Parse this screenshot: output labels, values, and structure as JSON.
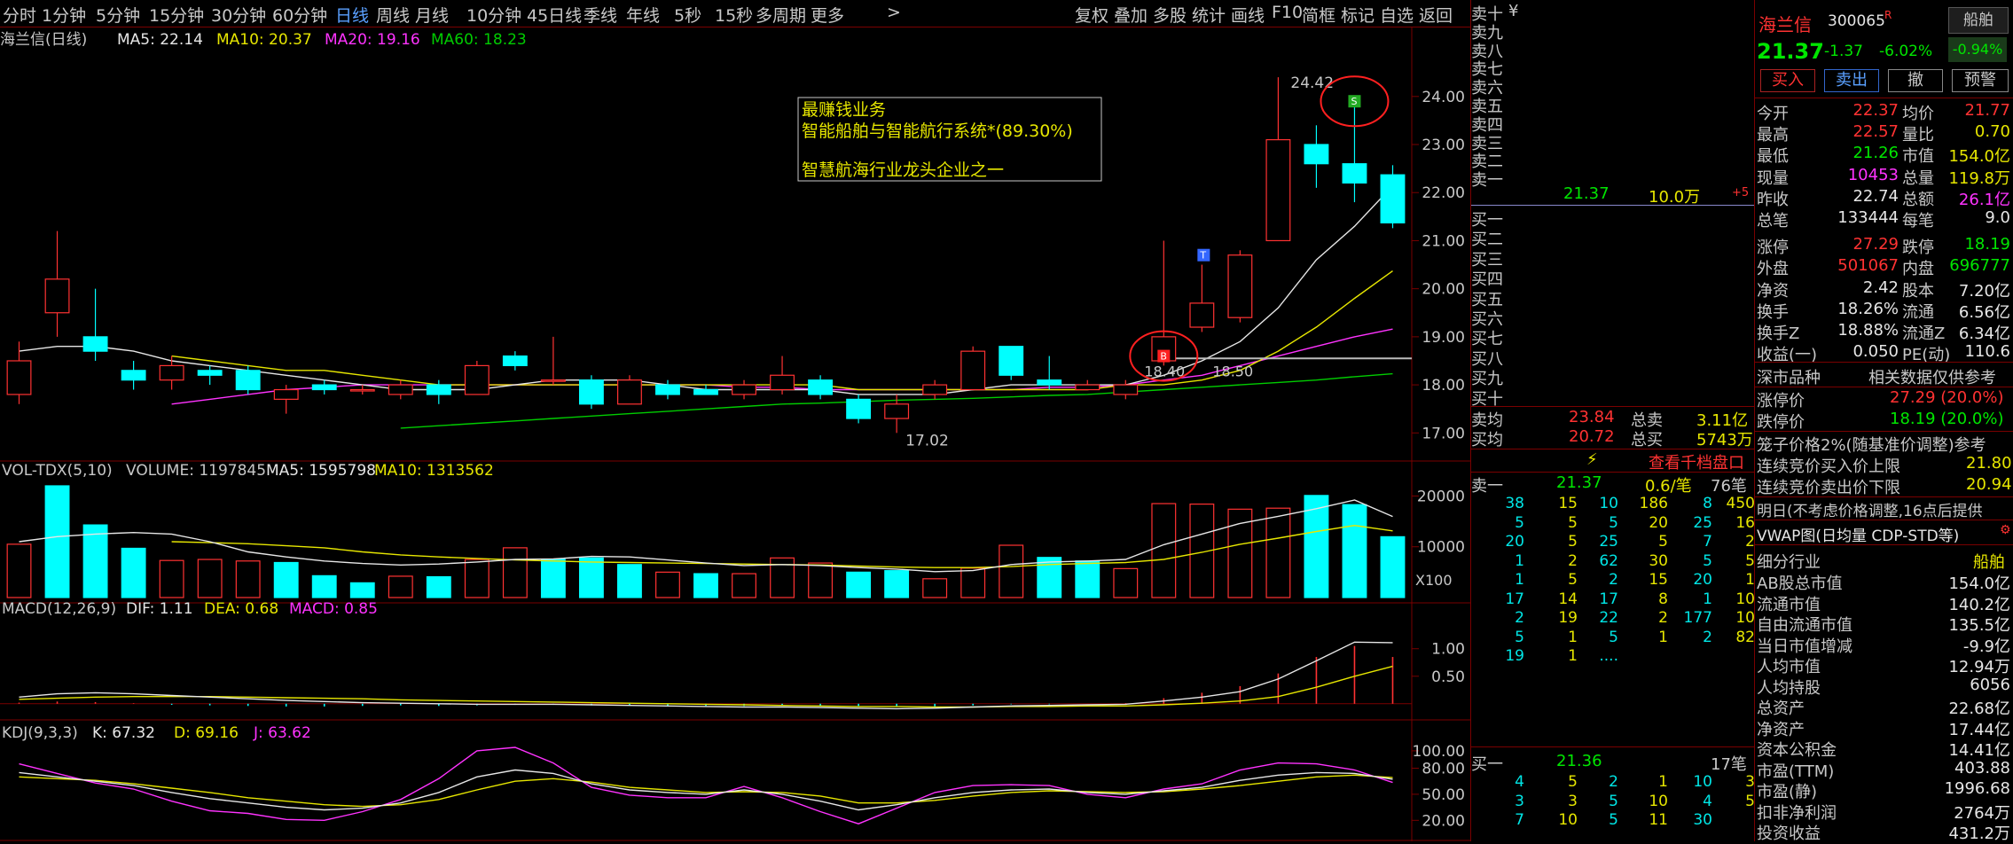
{
  "tabs": [
    "分时",
    "1分钟",
    "5分钟",
    "15分钟",
    "30分钟",
    "60分钟",
    "日线",
    "周线",
    "月线",
    "10分钟",
    "45日线",
    "季线",
    "年线",
    "5秒",
    "15秒",
    "多周期",
    "更多"
  ],
  "tab_more_icon": "chevron-right-icon",
  "active_tab_index": 6,
  "right_tools": [
    "复权",
    "叠加",
    "多股",
    "统计",
    "画线",
    "F10",
    "简框",
    "标记",
    "自选",
    "返回"
  ],
  "price_panel": {
    "title": "海兰信(日线)",
    "ma5_label": "MA5: 22.14",
    "ma10_label": "MA10: 20.37",
    "ma20_label": "MA20: 19.16",
    "ma60_label": "MA60: 18.23",
    "y_ticks": [
      "24.00",
      "23.00",
      "22.00",
      "21.00",
      "20.00",
      "19.00",
      "18.00",
      "17.00"
    ],
    "high_label": "24.42",
    "low_label": "17.02",
    "level_label_a": "18.40",
    "level_label_b": "18.50",
    "marker_b": "B",
    "marker_s": "S",
    "marker_t": "T",
    "note_line1": "最赚钱业务",
    "note_line2": "智能船舶与智能航行系统*(89.30%)",
    "note_line3": "智慧航海行业龙头企业之一"
  },
  "vol_panel": {
    "title": "VOL-TDX(5,10)",
    "volume_label": "VOLUME: 1197845",
    "ma5_label": "MA5: 1595798",
    "ma10_label": "MA10: 1313562",
    "y_ticks": [
      "20000",
      "10000"
    ],
    "unit": "X100"
  },
  "macd_panel": {
    "title": "MACD(12,26,9)",
    "dif_label": "DIF: 1.11",
    "dea_label": "DEA: 0.68",
    "macd_label": "MACD: 0.85",
    "y_ticks": [
      "1.00",
      "0.50"
    ]
  },
  "kdj_panel": {
    "title": "KDJ(9,3,3)",
    "k_label": "K: 67.32",
    "d_label": "D: 69.16",
    "j_label": "J: 63.62",
    "y_ticks": [
      "100.00",
      "80.00",
      "50.00",
      "20.00"
    ]
  },
  "colors": {
    "up": "#ff3232",
    "down": "#00ffff",
    "ma5": "#e6e6e6",
    "ma10": "#e6e600",
    "ma20": "#ff33ff",
    "ma60": "#00cc00",
    "grid": "#7a0000"
  },
  "book": {
    "asks": [
      "卖十",
      "卖九",
      "卖八",
      "卖七",
      "卖六",
      "卖五",
      "卖四",
      "卖三",
      "卖二",
      "卖一"
    ],
    "ask_top_symbol": "¥",
    "ask1_price": "21.37",
    "ask1_vol": "10.0万",
    "ask1_change": "+5",
    "bids": [
      "买一",
      "买二",
      "买三",
      "买四",
      "买五",
      "买六",
      "买七",
      "买八",
      "买九",
      "买十"
    ],
    "avg_ask_label": "卖均",
    "avg_ask": "23.84",
    "total_ask_label": "总卖",
    "total_ask": "3.11亿",
    "avg_bid_label": "买均",
    "avg_bid": "20.72",
    "total_bid_label": "总买",
    "total_bid": "5743万",
    "thousand_link": "查看千档盘口",
    "sell1_label": "卖一",
    "sell1_price": "21.37",
    "sell1_vol": "0.6/笔",
    "sell1_count": "76笔",
    "sell_queue": [
      [
        "38",
        "15",
        "10",
        "186",
        "8",
        "450"
      ],
      [
        "5",
        "5",
        "5",
        "20",
        "25",
        "16"
      ],
      [
        "20",
        "5",
        "25",
        "5",
        "7",
        "2"
      ],
      [
        "1",
        "2",
        "62",
        "30",
        "5",
        "5"
      ],
      [
        "1",
        "5",
        "2",
        "15",
        "20",
        "1"
      ],
      [
        "17",
        "14",
        "17",
        "8",
        "1",
        "10"
      ],
      [
        "2",
        "19",
        "22",
        "2",
        "177",
        "10"
      ],
      [
        "5",
        "1",
        "5",
        "1",
        "2",
        "82"
      ],
      [
        "19",
        "1",
        "....",
        "",
        "",
        ""
      ]
    ],
    "buy1_label": "买一",
    "buy1_price": "21.36",
    "buy1_count": "17笔",
    "buy_queue": [
      [
        "4",
        "5",
        "2",
        "1",
        "10",
        "3"
      ],
      [
        "3",
        "3",
        "5",
        "10",
        "4",
        "5"
      ],
      [
        "7",
        "10",
        "5",
        "11",
        "30",
        ""
      ]
    ]
  },
  "quote": {
    "name": "海兰信",
    "code": "300065",
    "rzrq": "R",
    "industry_tag": "船舶",
    "price": "21.37",
    "change": "-1.37",
    "pct": "-6.02%",
    "small_pct": "-0.94%",
    "buttons": [
      "买入",
      "卖出",
      "撤",
      "预警"
    ],
    "rows": [
      [
        "今开",
        "22.37",
        "均价",
        "21.77"
      ],
      [
        "最高",
        "22.57",
        "量比",
        "0.70"
      ],
      [
        "最低",
        "21.26",
        "市值",
        "154.0亿"
      ],
      [
        "现量",
        "10453",
        "总量",
        "119.8万"
      ],
      [
        "昨收",
        "22.74",
        "总额",
        "26.1亿"
      ],
      [
        "总笔",
        "133444",
        "每笔",
        "9.0"
      ],
      [
        "涨停",
        "27.29",
        "跌停",
        "18.19"
      ],
      [
        "外盘",
        "501067",
        "内盘",
        "696777"
      ],
      [
        "净资",
        "2.42",
        "股本",
        "7.20亿"
      ],
      [
        "换手",
        "18.26%",
        "流通",
        "6.56亿"
      ],
      [
        "换手Z",
        "18.88%",
        "流通Z",
        "6.34亿"
      ],
      [
        "收益(一)",
        "0.050",
        "PE(动)",
        "110.6"
      ]
    ],
    "section_left": "深市品种",
    "section_right": "相关数据仅供参考",
    "limit_up_label": "涨停价",
    "limit_up": "27.29 (20.0%)",
    "limit_down_label": "跌停价",
    "limit_down": "18.19 (20.0%)",
    "cage_label": "笼子价格2%(随基准价调整)参考",
    "bid_limit_label": "连续竞价买入价上限",
    "bid_limit": "21.80",
    "ask_limit_label": "连续竞价卖出价下限",
    "ask_limit": "20.94",
    "tomorrow_note": "明日(不考虑价格调整,16点后提供",
    "vwap_label": "VWAP图(日均量 CDP-STD等)",
    "vwap_icon": "settings-icon",
    "industry_label": "细分行业",
    "industry_value": "船舶",
    "stats": [
      [
        "AB股总市值",
        "154.0亿"
      ],
      [
        "流通市值",
        "140.2亿"
      ],
      [
        "自由流通市值",
        "135.5亿"
      ],
      [
        "当日市值增减",
        "-9.9亿"
      ],
      [
        "人均市值",
        "12.94万"
      ],
      [
        "人均持股",
        "6056"
      ],
      [
        "总资产",
        "22.68亿"
      ],
      [
        "净资产",
        "17.44亿"
      ],
      [
        "资本公积金",
        "14.41亿"
      ],
      [
        "市盈(TTM)",
        "403.88"
      ],
      [
        "市盈(静)",
        "1996.68"
      ],
      [
        "扣非净利润",
        "2764万"
      ],
      [
        "投资收益",
        "431.2万"
      ]
    ]
  },
  "chart_data": [
    {
      "type": "candlestick",
      "title": "海兰信(日线)",
      "ylim": [
        16.6,
        24.9
      ],
      "y_ticks": [
        17,
        18,
        19,
        20,
        21,
        22,
        23,
        24
      ],
      "candles": [
        [
          17.8,
          18.5,
          17.6,
          18.9
        ],
        [
          19.5,
          20.2,
          19.0,
          21.2
        ],
        [
          19.0,
          18.7,
          18.5,
          20.0
        ],
        [
          18.3,
          18.1,
          17.9,
          18.5
        ],
        [
          18.1,
          18.4,
          17.9,
          18.6
        ],
        [
          18.3,
          18.2,
          18.0,
          18.4
        ],
        [
          18.3,
          17.9,
          17.8,
          18.4
        ],
        [
          17.7,
          17.9,
          17.4,
          18.0
        ],
        [
          18.0,
          17.9,
          17.8,
          18.1
        ],
        [
          17.9,
          17.9,
          17.8,
          18.0
        ],
        [
          17.8,
          18.0,
          17.7,
          18.1
        ],
        [
          18.0,
          17.8,
          17.6,
          18.1
        ],
        [
          17.8,
          18.4,
          17.8,
          18.5
        ],
        [
          18.6,
          18.4,
          18.3,
          18.7
        ],
        [
          18.1,
          18.1,
          18.0,
          19.0
        ],
        [
          18.1,
          17.6,
          17.5,
          18.2
        ],
        [
          17.6,
          18.1,
          17.6,
          18.2
        ],
        [
          18.0,
          17.8,
          17.7,
          18.1
        ],
        [
          17.9,
          17.8,
          17.8,
          18.0
        ],
        [
          17.8,
          18.0,
          17.7,
          18.1
        ],
        [
          17.9,
          18.2,
          17.8,
          18.6
        ],
        [
          18.1,
          17.8,
          17.7,
          18.2
        ],
        [
          17.7,
          17.3,
          17.2,
          17.8
        ],
        [
          17.3,
          17.6,
          17.0,
          17.8
        ],
        [
          17.8,
          18.0,
          17.7,
          18.1
        ],
        [
          17.9,
          18.7,
          17.9,
          18.8
        ],
        [
          18.8,
          18.2,
          18.1,
          18.8
        ],
        [
          18.1,
          18.0,
          17.9,
          18.6
        ],
        [
          17.9,
          18.0,
          17.9,
          18.1
        ],
        [
          17.8,
          18.0,
          17.7,
          18.1
        ],
        [
          18.5,
          19.0,
          18.4,
          21.0
        ],
        [
          19.2,
          19.7,
          19.1,
          20.5
        ],
        [
          19.4,
          20.7,
          19.3,
          20.8
        ],
        [
          21.0,
          23.1,
          21.0,
          24.4
        ],
        [
          23.0,
          22.6,
          22.1,
          23.4
        ],
        [
          22.6,
          22.2,
          21.8,
          23.8
        ],
        [
          22.37,
          21.37,
          21.26,
          22.57
        ]
      ],
      "ma5": [
        18.7,
        18.8,
        18.8,
        18.7,
        18.5,
        18.4,
        18.3,
        18.2,
        18.1,
        18.0,
        17.9,
        17.9,
        17.9,
        18.0,
        18.1,
        18.1,
        18.1,
        18.0,
        17.9,
        17.9,
        17.9,
        17.9,
        17.8,
        17.8,
        17.8,
        17.9,
        18.0,
        18.0,
        18.0,
        18.0,
        18.2,
        18.5,
        18.9,
        19.6,
        20.6,
        21.3,
        22.14
      ],
      "ma10": [
        null,
        null,
        null,
        null,
        18.6,
        18.5,
        18.4,
        18.3,
        18.3,
        18.2,
        18.1,
        18.0,
        18.0,
        18.0,
        18.0,
        18.0,
        18.0,
        18.0,
        18.0,
        18.0,
        18.0,
        18.0,
        17.9,
        17.9,
        17.9,
        17.9,
        17.9,
        17.9,
        17.9,
        18.0,
        18.0,
        18.1,
        18.3,
        18.7,
        19.2,
        19.8,
        20.37
      ],
      "ma20": [
        null,
        null,
        null,
        null,
        17.6,
        17.7,
        17.8,
        17.9,
        17.95,
        18.0,
        18.0,
        18.0,
        18.0,
        18.0,
        18.0,
        18.0,
        18.0,
        18.0,
        18.0,
        17.95,
        17.95,
        17.9,
        17.9,
        17.9,
        17.9,
        17.9,
        17.9,
        17.95,
        17.95,
        18.0,
        18.1,
        18.2,
        18.4,
        18.6,
        18.8,
        19.0,
        19.16
      ],
      "ma60": [
        null,
        null,
        null,
        null,
        null,
        null,
        null,
        null,
        null,
        null,
        17.1,
        17.15,
        17.2,
        17.25,
        17.3,
        17.35,
        17.4,
        17.45,
        17.5,
        17.55,
        17.6,
        17.62,
        17.65,
        17.68,
        17.7,
        17.72,
        17.75,
        17.78,
        17.8,
        17.85,
        17.9,
        17.95,
        18.0,
        18.05,
        18.1,
        18.17,
        18.23
      ],
      "levels": [
        18.55
      ]
    },
    {
      "type": "bar",
      "title": "VOL-TDX(5,10)",
      "ylim": [
        0,
        22000
      ],
      "values": [
        10500,
        22000,
        14300,
        9700,
        7300,
        7500,
        7200,
        6900,
        4300,
        2900,
        4200,
        4100,
        7500,
        9800,
        7500,
        7800,
        6500,
        5000,
        4700,
        4700,
        7800,
        6800,
        5000,
        5300,
        3700,
        5800,
        10300,
        7900,
        7200,
        5700,
        18500,
        18400,
        17400,
        17600,
        20100,
        18300,
        11978
      ],
      "down_indices": [
        1,
        2,
        3,
        7,
        8,
        9,
        11,
        14,
        15,
        16,
        18,
        22,
        23,
        27,
        28,
        34,
        35,
        36
      ],
      "ma5": [
        11000,
        12000,
        12500,
        12800,
        12500,
        11000,
        9000,
        8000,
        7200,
        6700,
        6400,
        6600,
        7000,
        7500,
        7600,
        8100,
        8000,
        7400,
        6800,
        6300,
        6500,
        6300,
        5900,
        5600,
        5100,
        5300,
        6500,
        7000,
        7200,
        7500,
        10400,
        12500,
        14600,
        16000,
        17500,
        19200,
        15958
      ],
      "ma10": [
        null,
        null,
        null,
        null,
        11000,
        10800,
        10600,
        10200,
        9800,
        9000,
        8400,
        8000,
        7700,
        7400,
        7200,
        7000,
        6900,
        6800,
        6700,
        6600,
        6500,
        6400,
        6200,
        6000,
        5900,
        5900,
        6100,
        6500,
        6700,
        6900,
        7500,
        8900,
        10500,
        11700,
        13000,
        14200,
        13136
      ]
    },
    {
      "type": "bar",
      "title": "MACD(12,26,9)",
      "ylim": [
        -0.1,
        1.35
      ],
      "values": [
        0.02,
        0.04,
        0.03,
        0.01,
        -0.02,
        -0.03,
        -0.04,
        -0.05,
        -0.05,
        -0.04,
        -0.03,
        -0.04,
        -0.03,
        -0.02,
        -0.02,
        -0.03,
        -0.03,
        -0.04,
        -0.04,
        -0.04,
        -0.03,
        -0.04,
        -0.05,
        -0.06,
        -0.05,
        -0.03,
        -0.01,
        -0.01,
        0.0,
        0.01,
        0.1,
        0.2,
        0.32,
        0.55,
        0.85,
        1.05,
        0.85
      ],
      "dif": [
        0.12,
        0.18,
        0.2,
        0.18,
        0.15,
        0.12,
        0.09,
        0.06,
        0.04,
        0.02,
        0.01,
        0.0,
        -0.01,
        -0.01,
        -0.01,
        -0.02,
        -0.03,
        -0.04,
        -0.05,
        -0.06,
        -0.06,
        -0.07,
        -0.08,
        -0.09,
        -0.08,
        -0.06,
        -0.04,
        -0.03,
        -0.02,
        -0.01,
        0.05,
        0.12,
        0.22,
        0.45,
        0.78,
        1.12,
        1.11
      ],
      "dea": [
        0.08,
        0.1,
        0.12,
        0.13,
        0.13,
        0.13,
        0.12,
        0.11,
        0.1,
        0.09,
        0.07,
        0.06,
        0.05,
        0.04,
        0.03,
        0.02,
        0.01,
        0.0,
        -0.01,
        -0.02,
        -0.03,
        -0.04,
        -0.05,
        -0.05,
        -0.06,
        -0.06,
        -0.05,
        -0.05,
        -0.04,
        -0.04,
        -0.02,
        0.01,
        0.05,
        0.13,
        0.3,
        0.5,
        0.68
      ]
    },
    {
      "type": "line",
      "title": "KDJ(9,3,3)",
      "ylim": [
        5,
        105
      ],
      "k": [
        75,
        70,
        65,
        60,
        52,
        45,
        40,
        35,
        32,
        34,
        40,
        52,
        70,
        78,
        74,
        62,
        55,
        52,
        50,
        55,
        50,
        42,
        32,
        38,
        46,
        52,
        55,
        56,
        52,
        50,
        54,
        58,
        66,
        72,
        75,
        74,
        67.32
      ],
      "d": [
        70,
        68,
        66,
        62,
        57,
        52,
        46,
        42,
        38,
        36,
        38,
        44,
        55,
        65,
        68,
        64,
        58,
        55,
        52,
        53,
        52,
        48,
        40,
        40,
        43,
        48,
        52,
        54,
        53,
        52,
        53,
        56,
        60,
        65,
        70,
        72,
        69.16
      ],
      "j": [
        85,
        74,
        63,
        56,
        42,
        31,
        28,
        21,
        20,
        30,
        44,
        68,
        100,
        104,
        86,
        58,
        49,
        46,
        46,
        59,
        46,
        30,
        16,
        34,
        52,
        60,
        61,
        60,
        50,
        46,
        56,
        62,
        78,
        86,
        85,
        78,
        63.62
      ]
    }
  ]
}
